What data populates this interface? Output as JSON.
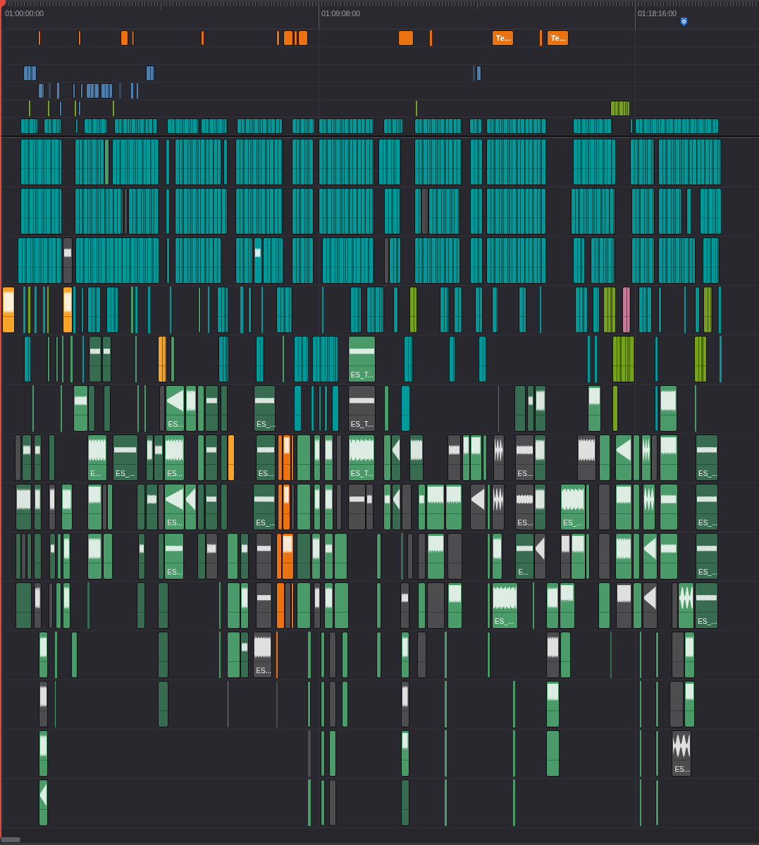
{
  "ruler": {
    "labels": [
      "01:00:00:00",
      "01:09:08:00",
      "01:18:16:00"
    ]
  },
  "tracks": [
    {
      "kind": "title",
      "clips": [
        {
          "kind": "clip",
          "color": "#ea7210"
        },
        {
          "kind": "clip",
          "color": "#ea7210"
        },
        {
          "kind": "clip",
          "color": "#ea7210"
        },
        {
          "kind": "clip",
          "color": "#a35412"
        },
        {
          "kind": "clip",
          "color": "#ea7210"
        },
        {
          "kind": "clip",
          "color": "#ea7210"
        },
        {
          "kind": "clip",
          "color": "#ea7210"
        },
        {
          "kind": "clip",
          "color": "#ea7210"
        },
        {
          "kind": "clip",
          "color": "#ea7210"
        },
        {
          "kind": "clip",
          "color": "#ea7210"
        },
        {
          "kind": "clip",
          "color": "#ea7210"
        },
        {
          "kind": "clip",
          "color": "#ea7210",
          "label": "Te..."
        },
        {
          "kind": "clip",
          "color": "#ea7210"
        },
        {
          "kind": "clip",
          "color": "#ea7210",
          "label": "Te..."
        }
      ]
    },
    {
      "kind": "video"
    },
    {
      "kind": "video",
      "clips": [
        {
          "kind": "clip",
          "color": "#4f7fad"
        },
        {
          "kind": "clip",
          "color": "#4f7fad"
        },
        {
          "kind": "clip",
          "color": "#2e4a66"
        },
        {
          "kind": "clip",
          "color": "#4f7fad"
        }
      ]
    },
    {
      "kind": "video",
      "clips": [
        {
          "kind": "clip",
          "color": "#4f7fad"
        },
        {
          "kind": "clip",
          "color": "#2e4a66"
        },
        {
          "kind": "clip",
          "color": "#4f7fad"
        },
        {
          "kind": "clip",
          "color": "#4f7fad"
        },
        {
          "kind": "clip",
          "color": "#4f7fad"
        },
        {
          "kind": "clip",
          "color": "#4f7fad"
        },
        {
          "kind": "clip",
          "color": "#4f7fad"
        },
        {
          "kind": "clip",
          "color": "#2e4a66"
        },
        {
          "kind": "clip",
          "color": "#4f7fad"
        },
        {
          "kind": "clip",
          "color": "#4f7fad"
        }
      ]
    },
    {
      "kind": "video",
      "clips": [
        {
          "kind": "clip",
          "color": "#76a21d"
        },
        {
          "kind": "clip",
          "color": "#76a21d"
        },
        {
          "kind": "clip",
          "color": "#4f7fad"
        },
        {
          "kind": "clip",
          "color": "#76a21d"
        },
        {
          "kind": "clip",
          "color": "#4f7fad"
        },
        {
          "kind": "clip",
          "color": "#76a21d"
        },
        {
          "kind": "clip",
          "color": "#76a21d"
        },
        {
          "kind": "clip",
          "color": "#76a21d"
        }
      ]
    },
    {
      "kind": "video",
      "clips": [
        {
          "kind": "clip",
          "color": "#00999a"
        },
        {
          "kind": "clip",
          "color": "#00999a"
        },
        {
          "kind": "clip",
          "color": "#00999a"
        },
        {
          "kind": "clip",
          "color": "#00999a"
        },
        {
          "kind": "clip",
          "color": "#00999a"
        },
        {
          "kind": "clip",
          "color": "#00999a"
        },
        {
          "kind": "clip",
          "color": "#00999a"
        },
        {
          "kind": "clip",
          "color": "#00999a"
        },
        {
          "kind": "clip",
          "color": "#00999a"
        },
        {
          "kind": "clip",
          "color": "#00999a"
        },
        {
          "kind": "clip",
          "color": "#00999a"
        },
        {
          "kind": "clip",
          "color": "#00999a"
        },
        {
          "kind": "clip",
          "color": "#00999a"
        },
        {
          "kind": "clip",
          "color": "#00999a"
        },
        {
          "kind": "clip",
          "color": "#00999a"
        },
        {
          "kind": "clip",
          "color": "#00999a"
        },
        {
          "kind": "clip",
          "color": "#00999a"
        }
      ]
    },
    {
      "kind": "edit",
      "clips": [
        {
          "kind": "clip",
          "color": "#00999a"
        },
        {
          "kind": "clip",
          "color": "#00999a"
        },
        {
          "kind": "clip",
          "color": "#4b9a69"
        },
        {
          "kind": "clip",
          "color": "#00999a"
        },
        {
          "kind": "clip",
          "color": "#00999a"
        },
        {
          "kind": "clip",
          "color": "#00999a"
        },
        {
          "kind": "clip",
          "color": "#00999a"
        },
        {
          "kind": "clip",
          "color": "#00999a"
        },
        {
          "kind": "clip",
          "color": "#00999a"
        },
        {
          "kind": "clip",
          "color": "#00999a"
        },
        {
          "kind": "clip",
          "color": "#00999a"
        },
        {
          "kind": "clip",
          "color": "#00999a"
        },
        {
          "kind": "clip",
          "color": "#00999a"
        },
        {
          "kind": "clip",
          "color": "#00999a"
        },
        {
          "kind": "clip",
          "color": "#00999a"
        },
        {
          "kind": "clip",
          "color": "#00999a"
        },
        {
          "kind": "clip",
          "color": "#00999a"
        }
      ]
    },
    {
      "kind": "edit",
      "clips": [
        {
          "kind": "clip",
          "color": "#00999a"
        },
        {
          "kind": "clip",
          "color": "#00999a"
        },
        {
          "kind": "clip",
          "color": "#4d4d50"
        },
        {
          "kind": "clip",
          "color": "#00999a"
        },
        {
          "kind": "clip",
          "color": "#00999a"
        },
        {
          "kind": "clip",
          "color": "#00999a"
        },
        {
          "kind": "clip",
          "color": "#00999a"
        },
        {
          "kind": "clip",
          "color": "#00999a"
        },
        {
          "kind": "clip",
          "color": "#00999a"
        },
        {
          "kind": "clip",
          "color": "#00999a"
        },
        {
          "kind": "clip",
          "color": "#00999a"
        },
        {
          "kind": "clip",
          "color": "#4d4d50"
        },
        {
          "kind": "clip",
          "color": "#00999a"
        },
        {
          "kind": "clip",
          "color": "#00999a"
        },
        {
          "kind": "clip",
          "color": "#00999a"
        },
        {
          "kind": "clip",
          "color": "#00999a"
        },
        {
          "kind": "clip",
          "color": "#00999a"
        },
        {
          "kind": "clip",
          "color": "#00999a"
        },
        {
          "kind": "clip",
          "color": "#00999a"
        },
        {
          "kind": "clip",
          "color": "#00999a"
        }
      ]
    },
    {
      "kind": "edit",
      "clips": [
        {
          "kind": "clip",
          "color": "#00999a"
        },
        {
          "kind": "soft",
          "color": "#4d4d50"
        },
        {
          "kind": "clip",
          "color": "#00999a"
        },
        {
          "kind": "clip",
          "color": "#00999a"
        },
        {
          "kind": "clip",
          "color": "#00999a"
        },
        {
          "kind": "clip",
          "color": "#00999a"
        },
        {
          "kind": "soft",
          "color": "#00999a"
        },
        {
          "kind": "clip",
          "color": "#00999a"
        },
        {
          "kind": "clip",
          "color": "#00999a"
        },
        {
          "kind": "clip",
          "color": "#00999a"
        },
        {
          "kind": "clip",
          "color": "#4d4d50"
        },
        {
          "kind": "clip",
          "color": "#00999a"
        },
        {
          "kind": "clip",
          "color": "#00999a"
        },
        {
          "kind": "clip",
          "color": "#00999a"
        },
        {
          "kind": "clip",
          "color": "#00999a"
        },
        {
          "kind": "clip",
          "color": "#00999a"
        },
        {
          "kind": "clip",
          "color": "#00999a"
        },
        {
          "kind": "clip",
          "color": "#00999a"
        },
        {
          "kind": "clip",
          "color": "#00999a"
        },
        {
          "kind": "clip",
          "color": "#00999a"
        }
      ]
    },
    {
      "kind": "edit",
      "clips": [
        {
          "kind": "loud",
          "color": "#f7a428"
        },
        {
          "kind": "clip",
          "color": "#00999a"
        },
        {
          "kind": "clip",
          "color": "#76a21d"
        },
        {
          "kind": "clip",
          "color": "#00999a"
        },
        {
          "kind": "clip",
          "color": "#00999a"
        },
        {
          "kind": "clip",
          "color": "#76a21d"
        },
        {
          "kind": "loud",
          "color": "#f7a428"
        },
        {
          "kind": "clip",
          "color": "#00999a"
        },
        {
          "kind": "clip",
          "color": "#00999a"
        },
        {
          "kind": "clip",
          "color": "#00999a"
        },
        {
          "kind": "clip",
          "color": "#00999a"
        },
        {
          "kind": "clip",
          "color": "#4b9a69"
        },
        {
          "kind": "clip",
          "color": "#00999a"
        },
        {
          "kind": "clip",
          "color": "#00999a"
        },
        {
          "kind": "clip",
          "color": "#00999a"
        },
        {
          "kind": "clip",
          "color": "#4b9a69"
        },
        {
          "kind": "clip",
          "color": "#00999a"
        },
        {
          "kind": "clip",
          "color": "#00999a"
        },
        {
          "kind": "clip",
          "color": "#00999a"
        },
        {
          "kind": "clip",
          "color": "#00999a"
        },
        {
          "kind": "clip",
          "color": "#00999a"
        },
        {
          "kind": "clip",
          "color": "#00999a"
        },
        {
          "kind": "clip",
          "color": "#00999a"
        },
        {
          "kind": "clip",
          "color": "#00999a"
        },
        {
          "kind": "clip",
          "color": "#00999a"
        },
        {
          "kind": "clip",
          "color": "#00999a"
        },
        {
          "kind": "clip",
          "color": "#76a21d"
        },
        {
          "kind": "clip",
          "color": "#00999a"
        },
        {
          "kind": "clip",
          "color": "#00999a"
        },
        {
          "kind": "clip",
          "color": "#00999a"
        },
        {
          "kind": "clip",
          "color": "#00999a"
        },
        {
          "kind": "clip",
          "color": "#00999a"
        },
        {
          "kind": "clip",
          "color": "#00999a"
        },
        {
          "kind": "clip",
          "color": "#00999a"
        },
        {
          "kind": "clip",
          "color": "#00999a"
        },
        {
          "kind": "clip",
          "color": "#76a21d"
        },
        {
          "kind": "clip",
          "color": "#c47d97"
        },
        {
          "kind": "clip",
          "color": "#00999a"
        },
        {
          "kind": "clip",
          "color": "#00999a"
        },
        {
          "kind": "clip",
          "color": "#00999a"
        },
        {
          "kind": "clip",
          "color": "#00999a"
        },
        {
          "kind": "clip",
          "color": "#76a21d"
        },
        {
          "kind": "clip",
          "color": "#00999a"
        }
      ]
    },
    {
      "kind": "edit",
      "clips": [
        {
          "kind": "clip",
          "color": "#00999a"
        },
        {
          "kind": "clip",
          "color": "#4b9a69"
        },
        {
          "kind": "clip",
          "color": "#4b9a69"
        },
        {
          "kind": "clip",
          "color": "#4b9a69"
        },
        {
          "kind": "clip",
          "color": "#4b9a69"
        },
        {
          "kind": "clip",
          "color": "#00999a"
        },
        {
          "kind": "band",
          "color": "#386c50"
        },
        {
          "kind": "band",
          "color": "#386c50"
        },
        {
          "kind": "clip",
          "color": "#4b9a69"
        },
        {
          "kind": "clip",
          "color": "#f7a428"
        },
        {
          "kind": "clip",
          "color": "#4b9a69"
        },
        {
          "kind": "clip",
          "color": "#00999a"
        },
        {
          "kind": "clip",
          "color": "#00999a"
        },
        {
          "kind": "clip",
          "color": "#4b9a69"
        },
        {
          "kind": "clip",
          "color": "#00999a"
        },
        {
          "kind": "clip",
          "color": "#00999a"
        },
        {
          "kind": "band",
          "color": "#4b9a69",
          "label": "ES_T..."
        },
        {
          "kind": "clip",
          "color": "#00999a"
        },
        {
          "kind": "clip",
          "color": "#00999a"
        },
        {
          "kind": "clip",
          "color": "#00999a"
        },
        {
          "kind": "clip",
          "color": "#00999a"
        },
        {
          "kind": "clip",
          "color": "#00999a"
        },
        {
          "kind": "clip",
          "color": "#76a21d"
        },
        {
          "kind": "clip",
          "color": "#00999a"
        },
        {
          "kind": "clip",
          "color": "#76a21d"
        },
        {
          "kind": "clip",
          "color": "#00999a"
        }
      ]
    },
    {
      "kind": "audio",
      "clips": [
        {
          "kind": "clip",
          "color": "#4b9a69"
        },
        {
          "kind": "clip",
          "color": "#4b9a69"
        },
        {
          "kind": "soft",
          "color": "#4b9a69"
        },
        {
          "kind": "clip",
          "color": "#386c50"
        },
        {
          "kind": "clip",
          "color": "#386c50"
        },
        {
          "kind": "clip",
          "color": "#4b9a69"
        },
        {
          "kind": "clip",
          "color": "#4b9a69"
        },
        {
          "kind": "clip",
          "color": "#4d4d50"
        },
        {
          "kind": "swell",
          "color": "#4b9a69",
          "label": "ES..."
        },
        {
          "kind": "loud",
          "color": "#4b9a69"
        },
        {
          "kind": "clip",
          "color": "#4b9a69"
        },
        {
          "kind": "band",
          "color": "#386c50"
        },
        {
          "kind": "clip",
          "color": "#386c50"
        },
        {
          "kind": "band",
          "color": "#386c50",
          "label": "ES_..."
        },
        {
          "kind": "clip",
          "color": "#00999a"
        },
        {
          "kind": "clip",
          "color": "#00999a"
        },
        {
          "kind": "clip",
          "color": "#00999a"
        },
        {
          "kind": "clip",
          "color": "#00999a"
        },
        {
          "kind": "clip",
          "color": "#00999a"
        },
        {
          "kind": "band",
          "color": "#4d4d50",
          "label": "ES_T..."
        },
        {
          "kind": "clip",
          "color": "#4b9a69"
        },
        {
          "kind": "clip",
          "color": "#00999a"
        },
        {
          "kind": "clip",
          "color": "#00999a"
        },
        {
          "kind": "clip",
          "color": "#386c50"
        },
        {
          "kind": "soft",
          "color": "#386c50"
        },
        {
          "kind": "loud",
          "color": "#386c50"
        },
        {
          "kind": "full",
          "color": "#4b9a69"
        },
        {
          "kind": "clip",
          "color": "#76a21d"
        },
        {
          "kind": "clip",
          "color": "#00999a"
        },
        {
          "kind": "loud",
          "color": "#4b9a69"
        },
        {
          "kind": "clip",
          "color": "#4b9a69"
        }
      ]
    },
    {
      "kind": "audio",
      "clips": [
        {
          "kind": "clip",
          "color": "#4d4d50"
        },
        {
          "kind": "soft",
          "color": "#386c50"
        },
        {
          "kind": "soft",
          "color": "#386c50"
        },
        {
          "kind": "clip",
          "color": "#386c50"
        },
        {
          "kind": "loud",
          "color": "#4b9a69",
          "label": "E..."
        },
        {
          "kind": "band",
          "color": "#386c50",
          "label": "ES_..."
        },
        {
          "kind": "loud",
          "color": "#386c50"
        },
        {
          "kind": "soft",
          "color": "#386c50"
        },
        {
          "kind": "loud",
          "color": "#4b9a69",
          "label": "ES..."
        },
        {
          "kind": "clip",
          "color": "#4b9a69"
        },
        {
          "kind": "band",
          "color": "#386c50"
        },
        {
          "kind": "clip",
          "color": "#386c50"
        },
        {
          "kind": "clip",
          "color": "#f7a428"
        },
        {
          "kind": "band",
          "color": "#386c50",
          "label": "ES..."
        },
        {
          "kind": "clip",
          "color": "#ea7210"
        },
        {
          "kind": "full",
          "color": "#ea7210"
        },
        {
          "kind": "clip",
          "color": "#ea7210"
        },
        {
          "kind": "clip",
          "color": "#4b9a69"
        },
        {
          "kind": "loud",
          "color": "#4b9a69"
        },
        {
          "kind": "loud",
          "color": "#4b9a69"
        },
        {
          "kind": "clip",
          "color": "#4d4d50"
        },
        {
          "kind": "loud",
          "color": "#4b9a69",
          "label": "ES_T..."
        },
        {
          "kind": "clip",
          "color": "#4b9a69"
        },
        {
          "kind": "swell",
          "color": "#386c50"
        },
        {
          "kind": "loud",
          "color": "#386c50"
        },
        {
          "kind": "soft",
          "color": "#4d4d50"
        },
        {
          "kind": "full",
          "color": "#4b9a69"
        },
        {
          "kind": "full",
          "color": "#4b9a69"
        },
        {
          "kind": "clip",
          "color": "#4b9a69"
        },
        {
          "kind": "spiky",
          "color": "#4d4d50"
        },
        {
          "kind": "soft",
          "color": "#4d4d50",
          "label": "ES..."
        },
        {
          "kind": "loud",
          "color": "#386c50"
        },
        {
          "kind": "loud",
          "color": "#4d4d50"
        },
        {
          "kind": "clip",
          "color": "#4b9a69"
        },
        {
          "kind": "swell",
          "color": "#4b9a69"
        },
        {
          "kind": "clip",
          "color": "#4b9a69"
        },
        {
          "kind": "spiky",
          "color": "#4b9a69"
        },
        {
          "kind": "clip",
          "color": "#4d4d50"
        },
        {
          "kind": "full",
          "color": "#4b9a69"
        },
        {
          "kind": "band",
          "color": "#386c50",
          "label": "ES_..."
        }
      ]
    },
    {
      "kind": "audio",
      "clips": [
        {
          "kind": "loud",
          "color": "#386c50"
        },
        {
          "kind": "loud",
          "color": "#386c50"
        },
        {
          "kind": "loud",
          "color": "#4d4d50"
        },
        {
          "kind": "loud",
          "color": "#4b9a69"
        },
        {
          "kind": "full",
          "color": "#4b9a69"
        },
        {
          "kind": "clip",
          "color": "#4d4d50"
        },
        {
          "kind": "clip",
          "color": "#4b9a69"
        },
        {
          "kind": "clip",
          "color": "#386c50"
        },
        {
          "kind": "soft",
          "color": "#386c50"
        },
        {
          "kind": "clip",
          "color": "#4d4d50"
        },
        {
          "kind": "swell",
          "color": "#4b9a69",
          "label": "ES..."
        },
        {
          "kind": "swell",
          "color": "#4b9a69"
        },
        {
          "kind": "clip",
          "color": "#386c50"
        },
        {
          "kind": "band",
          "color": "#386c50"
        },
        {
          "kind": "clip",
          "color": "#386c50"
        },
        {
          "kind": "band",
          "color": "#386c50",
          "label": "ES_..."
        },
        {
          "kind": "clip",
          "color": "#ea7210"
        },
        {
          "kind": "full",
          "color": "#ea7210"
        },
        {
          "kind": "clip",
          "color": "#4d4d50"
        },
        {
          "kind": "clip",
          "color": "#4b9a69"
        },
        {
          "kind": "loud",
          "color": "#4b9a69"
        },
        {
          "kind": "loud",
          "color": "#4b9a69"
        },
        {
          "kind": "clip",
          "color": "#4d4d50"
        },
        {
          "kind": "band",
          "color": "#4d4d50"
        },
        {
          "kind": "soft",
          "color": "#4d4d50"
        },
        {
          "kind": "soft",
          "color": "#4b9a69"
        },
        {
          "kind": "swell",
          "color": "#386c50"
        },
        {
          "kind": "clip",
          "color": "#4d4d50"
        },
        {
          "kind": "soft",
          "color": "#4b9a69"
        },
        {
          "kind": "full",
          "color": "#4b9a69"
        },
        {
          "kind": "full",
          "color": "#4b9a69"
        },
        {
          "kind": "swell",
          "color": "#4d4d50"
        },
        {
          "kind": "clip",
          "color": "#4b9a69"
        },
        {
          "kind": "spiky",
          "color": "#4d4d50"
        },
        {
          "kind": "soft",
          "color": "#4d4d50",
          "label": "ES..."
        },
        {
          "kind": "loud",
          "color": "#386c50"
        },
        {
          "kind": "loud",
          "color": "#4b9a69",
          "label": "ES_..."
        },
        {
          "kind": "clip",
          "color": "#4b9a69"
        },
        {
          "kind": "clip",
          "color": "#4d4d50"
        },
        {
          "kind": "full",
          "color": "#4b9a69"
        },
        {
          "kind": "clip",
          "color": "#4b9a69"
        },
        {
          "kind": "spiky",
          "color": "#4b9a69"
        },
        {
          "kind": "soft",
          "color": "#4b9a69"
        },
        {
          "kind": "band",
          "color": "#386c50",
          "label": "ES_..."
        }
      ]
    },
    {
      "kind": "audio",
      "clips": [
        {
          "kind": "clip",
          "color": "#386c50"
        },
        {
          "kind": "clip",
          "color": "#4d4d50"
        },
        {
          "kind": "clip",
          "color": "#386c50"
        },
        {
          "kind": "clip",
          "color": "#386c50"
        },
        {
          "kind": "soft",
          "color": "#386c50"
        },
        {
          "kind": "clip",
          "color": "#4b9a69"
        },
        {
          "kind": "loud",
          "color": "#4b9a69"
        },
        {
          "kind": "loud",
          "color": "#4b9a69"
        },
        {
          "kind": "clip",
          "color": "#4b9a69"
        },
        {
          "kind": "soft",
          "color": "#386c50"
        },
        {
          "kind": "clip",
          "color": "#386c50"
        },
        {
          "kind": "band",
          "color": "#4b9a69",
          "label": "ES..."
        },
        {
          "kind": "clip",
          "color": "#386c50"
        },
        {
          "kind": "soft",
          "color": "#4d4d50"
        },
        {
          "kind": "clip",
          "color": "#4b9a69"
        },
        {
          "kind": "soft",
          "color": "#386c50"
        },
        {
          "kind": "band",
          "color": "#4d4d50"
        },
        {
          "kind": "clip",
          "color": "#ea7210"
        },
        {
          "kind": "full",
          "color": "#ea7210"
        },
        {
          "kind": "clip",
          "color": "#386c50"
        },
        {
          "kind": "loud",
          "color": "#4b9a69"
        },
        {
          "kind": "soft",
          "color": "#4b9a69"
        },
        {
          "kind": "clip",
          "color": "#4b9a69"
        },
        {
          "kind": "clip",
          "color": "#4b9a69"
        },
        {
          "kind": "clip",
          "color": "#386c50"
        },
        {
          "kind": "clip",
          "color": "#4d4d50"
        },
        {
          "kind": "clip",
          "color": "#4d4d50"
        },
        {
          "kind": "full",
          "color": "#4b9a69"
        },
        {
          "kind": "clip",
          "color": "#4d4d50"
        },
        {
          "kind": "clip",
          "color": "#4b9a69"
        },
        {
          "kind": "loud",
          "color": "#4b9a69"
        },
        {
          "kind": "band",
          "color": "#386c50",
          "label": "E..."
        },
        {
          "kind": "swell",
          "color": "#4d4d50"
        },
        {
          "kind": "full",
          "color": "#4d4d50"
        },
        {
          "kind": "full",
          "color": "#4b9a69"
        },
        {
          "kind": "clip",
          "color": "#4b9a69"
        },
        {
          "kind": "clip",
          "color": "#4d4d50"
        },
        {
          "kind": "loud",
          "color": "#4b9a69"
        },
        {
          "kind": "clip",
          "color": "#4b9a69"
        },
        {
          "kind": "swell",
          "color": "#4b9a69"
        },
        {
          "kind": "soft",
          "color": "#4b9a69"
        },
        {
          "kind": "band",
          "color": "#386c50",
          "label": "ES_..."
        }
      ]
    },
    {
      "kind": "audio",
      "clips": [
        {
          "kind": "clip",
          "color": "#386c50"
        },
        {
          "kind": "loud",
          "color": "#4d4d50"
        },
        {
          "kind": "clip",
          "color": "#4d4d50"
        },
        {
          "kind": "clip",
          "color": "#4b9a69"
        },
        {
          "kind": "loud",
          "color": "#4b9a69"
        },
        {
          "kind": "clip",
          "color": "#386c50"
        },
        {
          "kind": "clip",
          "color": "#386c50"
        },
        {
          "kind": "clip",
          "color": "#386c50"
        },
        {
          "kind": "clip",
          "color": "#4b9a69"
        },
        {
          "kind": "clip",
          "color": "#4b9a69"
        },
        {
          "kind": "loud",
          "color": "#4b9a69"
        },
        {
          "kind": "band",
          "color": "#4d4d50"
        },
        {
          "kind": "clip",
          "color": "#ea7210"
        },
        {
          "kind": "clip",
          "color": "#4d4d50"
        },
        {
          "kind": "clip",
          "color": "#ea7210"
        },
        {
          "kind": "clip",
          "color": "#4b9a69"
        },
        {
          "kind": "loud",
          "color": "#4d4d50"
        },
        {
          "kind": "loud",
          "color": "#4b9a69"
        },
        {
          "kind": "clip",
          "color": "#4b9a69"
        },
        {
          "kind": "clip",
          "color": "#4b9a69"
        },
        {
          "kind": "soft",
          "color": "#4d4d50"
        },
        {
          "kind": "clip",
          "color": "#4b9a69"
        },
        {
          "kind": "clip",
          "color": "#4d4d50"
        },
        {
          "kind": "full",
          "color": "#4b9a69"
        },
        {
          "kind": "clip",
          "color": "#4b9a69"
        },
        {
          "kind": "loud",
          "color": "#4b9a69",
          "label": "ES_..."
        },
        {
          "kind": "clip",
          "color": "#4b9a69"
        },
        {
          "kind": "loud",
          "color": "#4b9a69"
        },
        {
          "kind": "full",
          "color": "#4b9a69"
        },
        {
          "kind": "clip",
          "color": "#4b9a69"
        },
        {
          "kind": "full",
          "color": "#4d4d50"
        },
        {
          "kind": "clip",
          "color": "#4b9a69"
        },
        {
          "kind": "swell",
          "color": "#4d4d50"
        },
        {
          "kind": "clip",
          "color": "#4d4d50"
        },
        {
          "kind": "spiky",
          "color": "#4b9a69"
        },
        {
          "kind": "band",
          "color": "#386c50",
          "label": "ES_..."
        }
      ]
    },
    {
      "kind": "audio",
      "clips": [
        {
          "kind": "loud",
          "color": "#4b9a69"
        },
        {
          "kind": "clip",
          "color": "#4b9a69"
        },
        {
          "kind": "clip",
          "color": "#4b9a69"
        },
        {
          "kind": "clip",
          "color": "#386c50"
        },
        {
          "kind": "clip",
          "color": "#4b9a69"
        },
        {
          "kind": "clip",
          "color": "#4b9a69"
        },
        {
          "kind": "soft",
          "color": "#386c50"
        },
        {
          "kind": "loud",
          "color": "#4d4d50",
          "label": "ES..."
        },
        {
          "kind": "clip",
          "color": "#ea7210"
        },
        {
          "kind": "clip",
          "color": "#4b9a69"
        },
        {
          "kind": "clip",
          "color": "#4b9a69"
        },
        {
          "kind": "clip",
          "color": "#4d4d50"
        },
        {
          "kind": "clip",
          "color": "#4b9a69"
        },
        {
          "kind": "clip",
          "color": "#4b9a69"
        },
        {
          "kind": "loud",
          "color": "#4b9a69"
        },
        {
          "kind": "clip",
          "color": "#4d4d50"
        },
        {
          "kind": "clip",
          "color": "#4b9a69"
        },
        {
          "kind": "clip",
          "color": "#4b9a69"
        },
        {
          "kind": "loud",
          "color": "#4d4d50"
        },
        {
          "kind": "clip",
          "color": "#4b9a69"
        },
        {
          "kind": "clip",
          "color": "#386c50"
        },
        {
          "kind": "clip",
          "color": "#4b9a69"
        },
        {
          "kind": "clip",
          "color": "#4b9a69"
        },
        {
          "kind": "clip",
          "color": "#4d4d50"
        },
        {
          "kind": "loud",
          "color": "#4b9a69"
        }
      ]
    },
    {
      "kind": "audio",
      "clips": [
        {
          "kind": "loud",
          "color": "#4d4d50"
        },
        {
          "kind": "clip",
          "color": "#4b9a69"
        },
        {
          "kind": "clip",
          "color": "#386c50"
        },
        {
          "kind": "clip",
          "color": "#4b9a69"
        },
        {
          "kind": "clip",
          "color": "#4d4d50"
        },
        {
          "kind": "clip",
          "color": "#4b9a69"
        },
        {
          "kind": "clip",
          "color": "#4b9a69"
        },
        {
          "kind": "clip",
          "color": "#4d4d50"
        },
        {
          "kind": "clip",
          "color": "#4b9a69"
        },
        {
          "kind": "loud",
          "color": "#4d4d50"
        },
        {
          "kind": "clip",
          "color": "#4b9a69"
        },
        {
          "kind": "clip",
          "color": "#4b9a69"
        },
        {
          "kind": "full",
          "color": "#4b9a69"
        },
        {
          "kind": "clip",
          "color": "#4b9a69"
        },
        {
          "kind": "clip",
          "color": "#4b9a69"
        },
        {
          "kind": "clip",
          "color": "#4d4d50"
        },
        {
          "kind": "full",
          "color": "#4b9a69"
        }
      ]
    },
    {
      "kind": "audio",
      "clips": [
        {
          "kind": "loud",
          "color": "#4b9a69"
        },
        {
          "kind": "clip",
          "color": "#4d4d50"
        },
        {
          "kind": "clip",
          "color": "#4b9a69"
        },
        {
          "kind": "clip",
          "color": "#4b9a69"
        },
        {
          "kind": "full",
          "color": "#4b9a69"
        },
        {
          "kind": "clip",
          "color": "#4b9a69"
        },
        {
          "kind": "clip",
          "color": "#4b9a69"
        },
        {
          "kind": "clip",
          "color": "#4b9a69"
        },
        {
          "kind": "clip",
          "color": "#4b9a69"
        },
        {
          "kind": "clip",
          "color": "#4b9a69"
        },
        {
          "kind": "spiky",
          "color": "#4d4d50",
          "label": "ES..."
        }
      ]
    },
    {
      "kind": "audio",
      "clips": [
        {
          "kind": "swell",
          "color": "#4b9a69"
        },
        {
          "kind": "clip",
          "color": "#4b9a69"
        },
        {
          "kind": "clip",
          "color": "#4b9a69"
        },
        {
          "kind": "clip",
          "color": "#4d4d50"
        },
        {
          "kind": "clip",
          "color": "#386c50"
        },
        {
          "kind": "clip",
          "color": "#4b9a69"
        },
        {
          "kind": "clip",
          "color": "#4b9a69"
        },
        {
          "kind": "clip",
          "color": "#4b9a69"
        },
        {
          "kind": "clip",
          "color": "#4b9a69"
        }
      ]
    }
  ]
}
